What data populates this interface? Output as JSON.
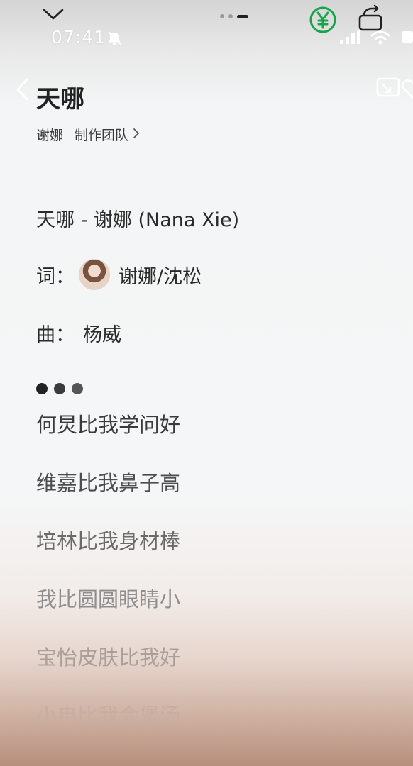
{
  "status_bar": {
    "time": "07:41",
    "icons": [
      "chevron-down-icon",
      "bell-off-icon",
      "yuan-icon",
      "rotate-icon",
      "signal-icon",
      "wifi-icon",
      "battery-icon"
    ]
  },
  "header": {
    "title": "天哪",
    "artist": "谢娜",
    "team_label": "制作团队",
    "chevron": "›"
  },
  "credits": {
    "song_line": "天哪 - 谢娜 (Nana Xie)",
    "lyricist_label": "词：",
    "lyricist_names": "谢娜/沈松",
    "composer_label": "曲：",
    "composer_name": "杨威"
  },
  "loading_dots": [
    "#222222",
    "#3b3b3b",
    "#555555"
  ],
  "lyrics": [
    {
      "text": "何炅比我学问好",
      "color": "#3a3a3a"
    },
    {
      "text": "维嘉比我鼻子高",
      "color": "#4d4d4d"
    },
    {
      "text": "培林比我身材棒",
      "color": "#6a6a6a"
    },
    {
      "text": "我比圆圆眼睛小",
      "color": "#8e8e8e"
    },
    {
      "text": "宝怡皮肤比我好",
      "color": "#ab9f9a"
    },
    {
      "text": "小冉比我会煲汤",
      "color": "#c6aea3"
    }
  ]
}
